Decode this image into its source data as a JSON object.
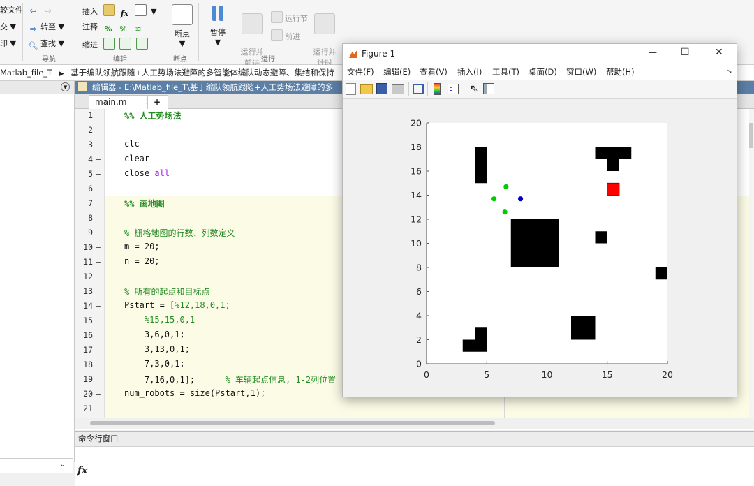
{
  "ribbon": {
    "file_col": [
      {
        "icon": "file-icon",
        "label": "较文件"
      },
      {
        "icon": "compare-icon",
        "label": "交"
      },
      {
        "icon": "print-icon",
        "label": "印"
      }
    ],
    "nav": {
      "goto_label": "转至",
      "find_label": "查找",
      "group_label": "导航"
    },
    "edit": {
      "insert_label": "插入",
      "comment_label": "注释",
      "indent_label": "缩进",
      "group_label": "编辑"
    },
    "breakpoints": {
      "button_label": "断点",
      "group_label": "断点"
    },
    "run": {
      "pause_label": "暂停",
      "run_advance_label": "运行并\n前进",
      "run_section_label": "运行节",
      "advance_label": "前进",
      "run_time_label": "运行并\n计时",
      "group_label": "运行"
    }
  },
  "address": {
    "path": "Matlab_file_T",
    "subfolder": "基于编队领航跟随+人工势场法避障的多智能体编队动态避障、集结和保持"
  },
  "editor": {
    "title": "编辑器 - E:\\Matlab_file_T\\基于编队领航跟随+人工势场法避障的多",
    "tab_label": "main.m",
    "add_tab": "+",
    "lines": [
      {
        "n": "1",
        "dash": "",
        "text": "%% 人工势场法",
        "kind": "cellhead"
      },
      {
        "n": "2",
        "dash": "",
        "text": "",
        "kind": "code"
      },
      {
        "n": "3",
        "dash": "—",
        "text": "clc",
        "kind": "code"
      },
      {
        "n": "4",
        "dash": "—",
        "text": "clear",
        "kind": "code"
      },
      {
        "n": "5",
        "dash": "—",
        "text": "close ",
        "kw": "all",
        "kind": "code"
      },
      {
        "n": "6",
        "dash": "",
        "text": "",
        "kind": "code"
      },
      {
        "n": "7",
        "dash": "",
        "text": "%% 画地图",
        "kind": "cellhead"
      },
      {
        "n": "8",
        "dash": "",
        "text": "",
        "kind": "code"
      },
      {
        "n": "9",
        "dash": "",
        "text": "% 栅格地图的行数、列数定义",
        "kind": "comment"
      },
      {
        "n": "10",
        "dash": "—",
        "text": "m = 20;",
        "kind": "code"
      },
      {
        "n": "11",
        "dash": "—",
        "text": "n = 20;",
        "kind": "code"
      },
      {
        "n": "12",
        "dash": "",
        "text": "",
        "kind": "code"
      },
      {
        "n": "13",
        "dash": "",
        "text": "% 所有的起点和目标点",
        "kind": "comment"
      },
      {
        "n": "14",
        "dash": "—",
        "text": "Pstart = [",
        "comment": "%12,18,0,1;",
        "kind": "mixed"
      },
      {
        "n": "15",
        "dash": "",
        "text": "    %15,15,0,1",
        "kind": "comment"
      },
      {
        "n": "16",
        "dash": "",
        "text": "    3,6,0,1;",
        "kind": "code"
      },
      {
        "n": "17",
        "dash": "",
        "text": "    3,13,0,1;",
        "kind": "code"
      },
      {
        "n": "18",
        "dash": "",
        "text": "    7,3,0,1;",
        "kind": "code"
      },
      {
        "n": "19",
        "dash": "",
        "text": "    7,16,0,1];      ",
        "comment": "% 车辆起点信息, 1-2列位置",
        "kind": "mixed"
      },
      {
        "n": "20",
        "dash": "—",
        "text": "num_robots = size(Pstart,1);",
        "kind": "code"
      },
      {
        "n": "21",
        "dash": "",
        "text": "",
        "kind": "code"
      }
    ]
  },
  "command_window": {
    "title": "命令行窗口",
    "fx": "fx"
  },
  "figure": {
    "title": "Figure 1",
    "menu": [
      "文件(F)",
      "编辑(E)",
      "查看(V)",
      "插入(I)",
      "工具(T)",
      "桌面(D)",
      "窗口(W)",
      "帮助(H)"
    ],
    "window_controls": {
      "minimize": "—",
      "maximize": "☐",
      "close": "✕"
    },
    "tool_icons": [
      "new-figure-icon",
      "open-file-icon",
      "save-icon",
      "print-icon",
      "link-plot-icon",
      "colorbar-icon",
      "legend-icon",
      "pointer-icon",
      "property-editor-icon"
    ]
  },
  "chart_data": {
    "type": "scatter",
    "title": "",
    "xlabel": "",
    "ylabel": "",
    "xlim": [
      0,
      20
    ],
    "ylim": [
      0,
      20
    ],
    "xticks": [
      "0",
      "5",
      "10",
      "15",
      "20"
    ],
    "yticks": [
      "0",
      "2",
      "4",
      "6",
      "8",
      "10",
      "12",
      "14",
      "16",
      "18",
      "20"
    ],
    "grid": false,
    "obstacles": [
      {
        "x0": 4,
        "x1": 5,
        "y0": 15,
        "y1": 18
      },
      {
        "x0": 14,
        "x1": 17,
        "y0": 17,
        "y1": 18
      },
      {
        "x0": 15,
        "x1": 16,
        "y0": 16,
        "y1": 17
      },
      {
        "x0": 7,
        "x1": 11,
        "y0": 8,
        "y1": 12
      },
      {
        "x0": 14,
        "x1": 15,
        "y0": 10,
        "y1": 11
      },
      {
        "x0": 19,
        "x1": 20,
        "y0": 7,
        "y1": 8
      },
      {
        "x0": 12,
        "x1": 14,
        "y0": 2,
        "y1": 4
      },
      {
        "x0": 4,
        "x1": 5,
        "y0": 1,
        "y1": 3
      },
      {
        "x0": 3,
        "x1": 4,
        "y0": 1,
        "y1": 2
      }
    ],
    "target": {
      "x0": 15,
      "x1": 16,
      "y0": 14,
      "y1": 15,
      "color": "#ff0000"
    },
    "series": [
      {
        "name": "",
        "color": "#00cc00",
        "points": [
          [
            6.6,
            14.7
          ],
          [
            5.6,
            13.7
          ],
          [
            6.5,
            12.6
          ]
        ]
      },
      {
        "name": "",
        "color": "#0000cc",
        "points": [
          [
            7.8,
            13.7
          ]
        ]
      }
    ]
  }
}
